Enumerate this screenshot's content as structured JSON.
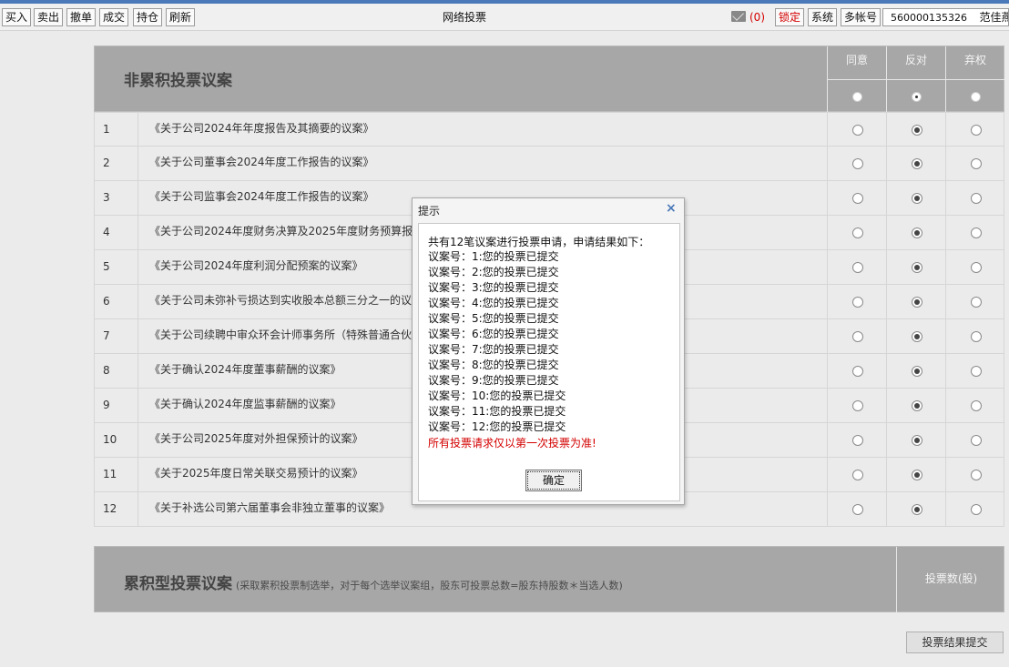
{
  "toolbar": {
    "buttons": [
      "买入",
      "卖出",
      "撤单",
      "成交",
      "持仓",
      "刷新"
    ],
    "title": "网络投票",
    "mail_count": "(0)",
    "lock_label": "锁定",
    "system_label": "系统",
    "multi_account_label": "多帐号",
    "account_number": "560000135326",
    "user_name": "范佳燕"
  },
  "section1": {
    "title": "非累积投票议案",
    "columns": [
      "同意",
      "反对",
      "弃权"
    ],
    "header_selected": "反对",
    "rows": [
      {
        "num": "1",
        "name": "《关于公司2024年年度报告及其摘要的议案》",
        "vote": "反对"
      },
      {
        "num": "2",
        "name": "《关于公司董事会2024年度工作报告的议案》",
        "vote": "反对"
      },
      {
        "num": "3",
        "name": "《关于公司监事会2024年度工作报告的议案》",
        "vote": "反对"
      },
      {
        "num": "4",
        "name": "《关于公司2024年度财务决算及2025年度财务预算报告",
        "vote": "反对"
      },
      {
        "num": "5",
        "name": "《关于公司2024年度利润分配预案的议案》",
        "vote": "反对"
      },
      {
        "num": "6",
        "name": "《关于公司未弥补亏损达到实收股本总额三分之一的议",
        "vote": "反对"
      },
      {
        "num": "7",
        "name": "《关于公司续聘中审众环会计师事务所（特殊普通合伙）",
        "vote": "反对"
      },
      {
        "num": "8",
        "name": "《关于确认2024年度董事薪酬的议案》",
        "vote": "反对"
      },
      {
        "num": "9",
        "name": "《关于确认2024年度监事薪酬的议案》",
        "vote": "反对"
      },
      {
        "num": "10",
        "name": "《关于公司2025年度对外担保预计的议案》",
        "vote": "反对"
      },
      {
        "num": "11",
        "name": "《关于2025年度日常关联交易预计的议案》",
        "vote": "反对"
      },
      {
        "num": "12",
        "name": "《关于补选公司第六届董事会非独立董事的议案》",
        "vote": "反对"
      }
    ]
  },
  "section2": {
    "title": "累积型投票议案",
    "note": "(采取累积投票制选举，对于每个选举议案组，股东可投票总数=股东持股数＊当选人数)",
    "column": "投票数(股)"
  },
  "submit_label": "投票结果提交",
  "dialog": {
    "title": "提示",
    "close_glyph": "×",
    "intro": "共有12笔议案进行投票申请，申请结果如下：",
    "lines": [
      "议案号：1:您的投票已提交",
      "议案号：2:您的投票已提交",
      "议案号：3:您的投票已提交",
      "议案号：4:您的投票已提交",
      "议案号：5:您的投票已提交",
      "议案号：6:您的投票已提交",
      "议案号：7:您的投票已提交",
      "议案号：8:您的投票已提交",
      "议案号：9:您的投票已提交",
      "议案号：10:您的投票已提交",
      "议案号：11:您的投票已提交",
      "议案号：12:您的投票已提交"
    ],
    "warning": "所有投票请求仅以第一次投票为准!",
    "ok_label": "确定"
  },
  "colors": {
    "accent": "#4a78b8",
    "warning": "#d40000",
    "header_bg": "#a7a7a7"
  }
}
